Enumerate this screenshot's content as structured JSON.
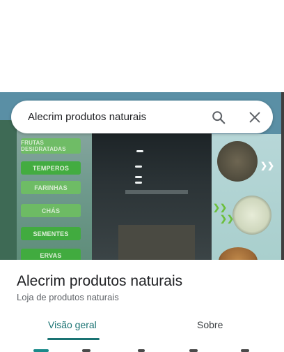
{
  "search": {
    "query": "Alecrim produtos naturais",
    "search_icon": "search-icon",
    "close_icon": "close-icon"
  },
  "photo": {
    "store_tags": [
      "FRUTAS DESIDRATADAS",
      "TEMPEROS",
      "FARINHAS",
      "CHÁS",
      "SEMENTES",
      "ERVAS"
    ]
  },
  "place": {
    "name": "Alecrim produtos naturais",
    "category": "Loja de produtos naturais"
  },
  "tabs": [
    {
      "label": "Visão geral",
      "active": true
    },
    {
      "label": "Sobre",
      "active": false
    }
  ],
  "colors": {
    "accent": "#1a7373",
    "tag_green": "#3fae3a"
  }
}
